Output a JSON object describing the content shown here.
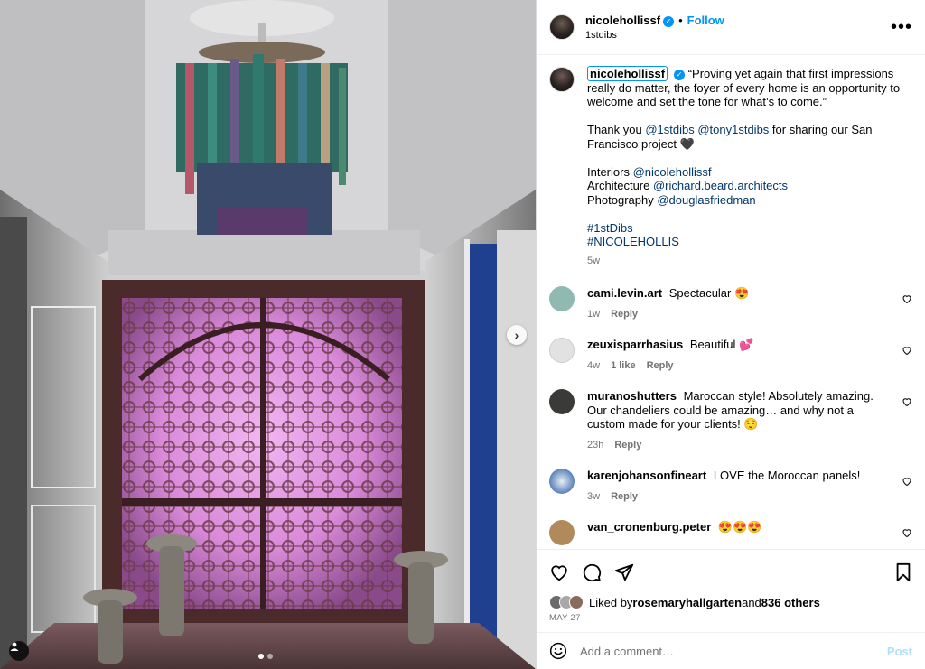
{
  "post": {
    "author": "nicolehollissf",
    "subtitle": "1stdibs",
    "follow_label": "Follow",
    "separator": "•",
    "more_label": "•••",
    "carousel_position": 1,
    "carousel_count": 2
  },
  "caption": {
    "user": "nicolehollissf",
    "lines": [
      "“Proving yet again that first impressions really do matter, the foyer of every home is an opportunity to welcome and set the tone for what’s to come.”"
    ],
    "thanks_pre": "Thank you ",
    "thanks_mention1": "@1stdibs",
    "thanks_mention2": "@tony1stdibs",
    "thanks_post": " for sharing our San Francisco project 🖤",
    "credit1_label": "Interiors ",
    "credit1_link": "@nicolehollissf",
    "credit2_label": "Architecture ",
    "credit2_link": "@richard.beard.architects",
    "credit3_label": "Photography ",
    "credit3_link": "@douglasfriedman",
    "tag1": "#1stDibs",
    "tag2": "#NICOLEHOLLIS",
    "time": "5w"
  },
  "comments": [
    {
      "user": "cami.levin.art",
      "text": "Spectacular 😍",
      "time": "1w",
      "likes": "",
      "reply": "Reply",
      "avatar_color": "#8fb9b1"
    },
    {
      "user": "zeuxisparrhasius",
      "text": "Beautiful 💕",
      "time": "4w",
      "likes": "1 like",
      "reply": "Reply",
      "avatar_color": "#d9d9d9"
    },
    {
      "user": "muranoshutters",
      "text": "Maroccan style! Absolutely amazing. Our chandeliers could be amazing… and why not a custom made for your clients! 😌",
      "time": "23h",
      "likes": "",
      "reply": "Reply",
      "avatar_color": "#3a3a38"
    },
    {
      "user": "karenjohansonfineart",
      "text": "LOVE the Moroccan panels!",
      "time": "3w",
      "likes": "",
      "reply": "Reply",
      "avatar_color": "#5a82b8"
    },
    {
      "user": "van_cronenburg.peter",
      "text": "😍😍😍",
      "time": "",
      "likes": "",
      "reply": "",
      "avatar_color": "#b08a5a"
    }
  ],
  "likes": {
    "prefix": "Liked by ",
    "user": "rosemaryhallgarten",
    "middle": " and ",
    "count": "836 others"
  },
  "date": "MAY 27",
  "add_comment": {
    "placeholder": "Add a comment…",
    "post_label": "Post"
  },
  "icons": {
    "verified": "verified-badge-icon",
    "more": "more-options-icon",
    "like": "heart-icon",
    "comment": "comment-icon",
    "share": "share-icon",
    "save": "bookmark-icon",
    "emoji": "emoji-icon",
    "next": "chevron-right-icon",
    "tags": "user-tag-icon"
  },
  "colors": {
    "accent": "#0095f6",
    "link": "#00376b",
    "muted": "#737373",
    "post_disabled": "#b2dffc"
  }
}
